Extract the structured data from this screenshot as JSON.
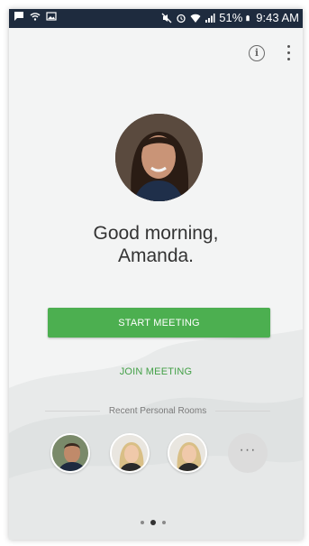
{
  "status_bar": {
    "left_icons": [
      "message-icon",
      "wifi-call-icon",
      "image-icon"
    ],
    "right_icons": [
      "mute-icon",
      "alarm-icon",
      "wifi-icon",
      "signal-icon",
      "battery-icon"
    ],
    "battery": "51%",
    "time": "9:43 AM"
  },
  "header": {
    "info_icon": "info-icon",
    "more_icon": "more-vert-icon"
  },
  "profile": {
    "greeting_line1": "Good morning,",
    "greeting_line2": "Amanda."
  },
  "actions": {
    "start_label": "START MEETING",
    "join_label": "JOIN MEETING"
  },
  "recent_rooms": {
    "label": "Recent Personal Rooms",
    "more_label": "···"
  },
  "pager": {
    "count": 3,
    "active_index": 1
  },
  "colors": {
    "status_bar": "#1e2b3e",
    "primary_green": "#4caf50",
    "link_green": "#43a047",
    "background": "#f3f4f4"
  }
}
